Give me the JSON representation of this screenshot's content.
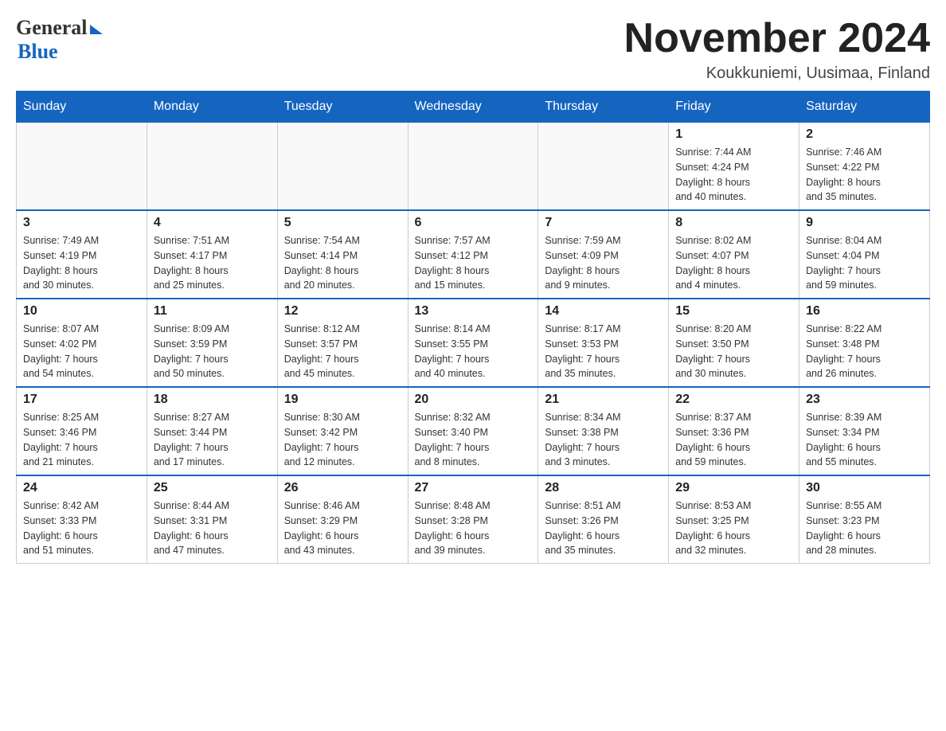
{
  "header": {
    "title": "November 2024",
    "location": "Koukkuniemi, Uusimaa, Finland",
    "logo_general": "General",
    "logo_blue": "Blue"
  },
  "weekdays": [
    "Sunday",
    "Monday",
    "Tuesday",
    "Wednesday",
    "Thursday",
    "Friday",
    "Saturday"
  ],
  "weeks": [
    {
      "days": [
        {
          "number": "",
          "info": ""
        },
        {
          "number": "",
          "info": ""
        },
        {
          "number": "",
          "info": ""
        },
        {
          "number": "",
          "info": ""
        },
        {
          "number": "",
          "info": ""
        },
        {
          "number": "1",
          "info": "Sunrise: 7:44 AM\nSunset: 4:24 PM\nDaylight: 8 hours\nand 40 minutes."
        },
        {
          "number": "2",
          "info": "Sunrise: 7:46 AM\nSunset: 4:22 PM\nDaylight: 8 hours\nand 35 minutes."
        }
      ]
    },
    {
      "days": [
        {
          "number": "3",
          "info": "Sunrise: 7:49 AM\nSunset: 4:19 PM\nDaylight: 8 hours\nand 30 minutes."
        },
        {
          "number": "4",
          "info": "Sunrise: 7:51 AM\nSunset: 4:17 PM\nDaylight: 8 hours\nand 25 minutes."
        },
        {
          "number": "5",
          "info": "Sunrise: 7:54 AM\nSunset: 4:14 PM\nDaylight: 8 hours\nand 20 minutes."
        },
        {
          "number": "6",
          "info": "Sunrise: 7:57 AM\nSunset: 4:12 PM\nDaylight: 8 hours\nand 15 minutes."
        },
        {
          "number": "7",
          "info": "Sunrise: 7:59 AM\nSunset: 4:09 PM\nDaylight: 8 hours\nand 9 minutes."
        },
        {
          "number": "8",
          "info": "Sunrise: 8:02 AM\nSunset: 4:07 PM\nDaylight: 8 hours\nand 4 minutes."
        },
        {
          "number": "9",
          "info": "Sunrise: 8:04 AM\nSunset: 4:04 PM\nDaylight: 7 hours\nand 59 minutes."
        }
      ]
    },
    {
      "days": [
        {
          "number": "10",
          "info": "Sunrise: 8:07 AM\nSunset: 4:02 PM\nDaylight: 7 hours\nand 54 minutes."
        },
        {
          "number": "11",
          "info": "Sunrise: 8:09 AM\nSunset: 3:59 PM\nDaylight: 7 hours\nand 50 minutes."
        },
        {
          "number": "12",
          "info": "Sunrise: 8:12 AM\nSunset: 3:57 PM\nDaylight: 7 hours\nand 45 minutes."
        },
        {
          "number": "13",
          "info": "Sunrise: 8:14 AM\nSunset: 3:55 PM\nDaylight: 7 hours\nand 40 minutes."
        },
        {
          "number": "14",
          "info": "Sunrise: 8:17 AM\nSunset: 3:53 PM\nDaylight: 7 hours\nand 35 minutes."
        },
        {
          "number": "15",
          "info": "Sunrise: 8:20 AM\nSunset: 3:50 PM\nDaylight: 7 hours\nand 30 minutes."
        },
        {
          "number": "16",
          "info": "Sunrise: 8:22 AM\nSunset: 3:48 PM\nDaylight: 7 hours\nand 26 minutes."
        }
      ]
    },
    {
      "days": [
        {
          "number": "17",
          "info": "Sunrise: 8:25 AM\nSunset: 3:46 PM\nDaylight: 7 hours\nand 21 minutes."
        },
        {
          "number": "18",
          "info": "Sunrise: 8:27 AM\nSunset: 3:44 PM\nDaylight: 7 hours\nand 17 minutes."
        },
        {
          "number": "19",
          "info": "Sunrise: 8:30 AM\nSunset: 3:42 PM\nDaylight: 7 hours\nand 12 minutes."
        },
        {
          "number": "20",
          "info": "Sunrise: 8:32 AM\nSunset: 3:40 PM\nDaylight: 7 hours\nand 8 minutes."
        },
        {
          "number": "21",
          "info": "Sunrise: 8:34 AM\nSunset: 3:38 PM\nDaylight: 7 hours\nand 3 minutes."
        },
        {
          "number": "22",
          "info": "Sunrise: 8:37 AM\nSunset: 3:36 PM\nDaylight: 6 hours\nand 59 minutes."
        },
        {
          "number": "23",
          "info": "Sunrise: 8:39 AM\nSunset: 3:34 PM\nDaylight: 6 hours\nand 55 minutes."
        }
      ]
    },
    {
      "days": [
        {
          "number": "24",
          "info": "Sunrise: 8:42 AM\nSunset: 3:33 PM\nDaylight: 6 hours\nand 51 minutes."
        },
        {
          "number": "25",
          "info": "Sunrise: 8:44 AM\nSunset: 3:31 PM\nDaylight: 6 hours\nand 47 minutes."
        },
        {
          "number": "26",
          "info": "Sunrise: 8:46 AM\nSunset: 3:29 PM\nDaylight: 6 hours\nand 43 minutes."
        },
        {
          "number": "27",
          "info": "Sunrise: 8:48 AM\nSunset: 3:28 PM\nDaylight: 6 hours\nand 39 minutes."
        },
        {
          "number": "28",
          "info": "Sunrise: 8:51 AM\nSunset: 3:26 PM\nDaylight: 6 hours\nand 35 minutes."
        },
        {
          "number": "29",
          "info": "Sunrise: 8:53 AM\nSunset: 3:25 PM\nDaylight: 6 hours\nand 32 minutes."
        },
        {
          "number": "30",
          "info": "Sunrise: 8:55 AM\nSunset: 3:23 PM\nDaylight: 6 hours\nand 28 minutes."
        }
      ]
    }
  ]
}
